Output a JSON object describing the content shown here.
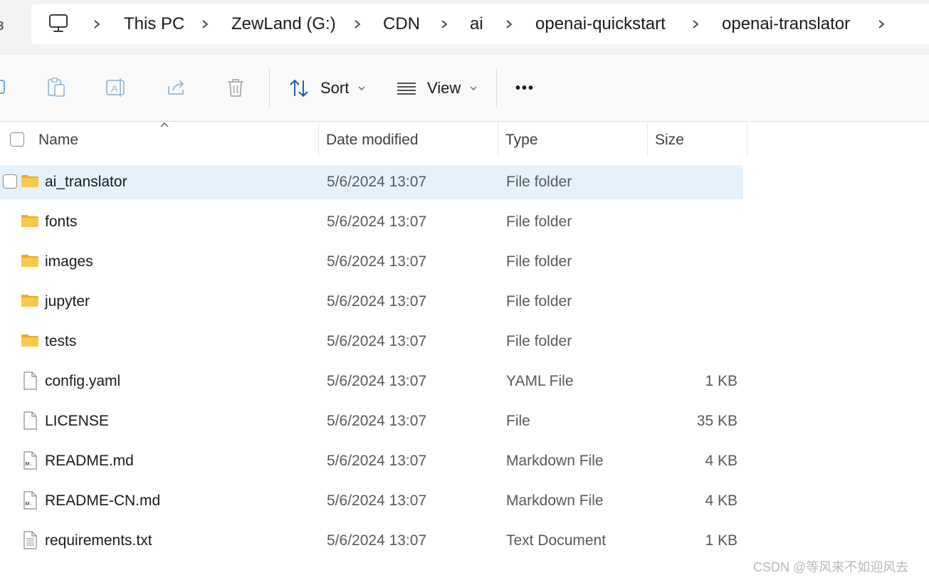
{
  "breadcrumb": {
    "root_icon": "computer-icon",
    "items": [
      "This PC",
      "ZewLand (G:)",
      "CDN",
      "ai",
      "openai-quickstart",
      "openai-translator"
    ]
  },
  "toolbar": {
    "icons": [
      "copy-icon",
      "paste-icon",
      "rename-icon",
      "share-icon",
      "delete-icon"
    ],
    "sort_label": "Sort",
    "view_label": "View",
    "more_label": "•••"
  },
  "columns": {
    "name": "Name",
    "date": "Date modified",
    "type": "Type",
    "size": "Size"
  },
  "files": [
    {
      "name": "ai_translator",
      "date": "5/6/2024 13:07",
      "type": "File folder",
      "size": "",
      "icon": "folder-icon",
      "selected": true
    },
    {
      "name": "fonts",
      "date": "5/6/2024 13:07",
      "type": "File folder",
      "size": "",
      "icon": "folder-icon"
    },
    {
      "name": "images",
      "date": "5/6/2024 13:07",
      "type": "File folder",
      "size": "",
      "icon": "folder-icon"
    },
    {
      "name": "jupyter",
      "date": "5/6/2024 13:07",
      "type": "File folder",
      "size": "",
      "icon": "folder-icon"
    },
    {
      "name": "tests",
      "date": "5/6/2024 13:07",
      "type": "File folder",
      "size": "",
      "icon": "folder-icon"
    },
    {
      "name": "config.yaml",
      "date": "5/6/2024 13:07",
      "type": "YAML File",
      "size": "1 KB",
      "icon": "file-icon"
    },
    {
      "name": "LICENSE",
      "date": "5/6/2024 13:07",
      "type": "File",
      "size": "35 KB",
      "icon": "file-icon"
    },
    {
      "name": "README.md",
      "date": "5/6/2024 13:07",
      "type": "Markdown File",
      "size": "4 KB",
      "icon": "markdown-file-icon"
    },
    {
      "name": "README-CN.md",
      "date": "5/6/2024 13:07",
      "type": "Markdown File",
      "size": "4 KB",
      "icon": "markdown-file-icon"
    },
    {
      "name": "requirements.txt",
      "date": "5/6/2024 13:07",
      "type": "Text Document",
      "size": "1 KB",
      "icon": "text-file-icon"
    }
  ],
  "watermark": "CSDN @等风来不如迎风去",
  "colors": {
    "selected_row": "#e5f1fb",
    "folder": "#f8c94a",
    "folder_dark": "#e8ae24"
  }
}
